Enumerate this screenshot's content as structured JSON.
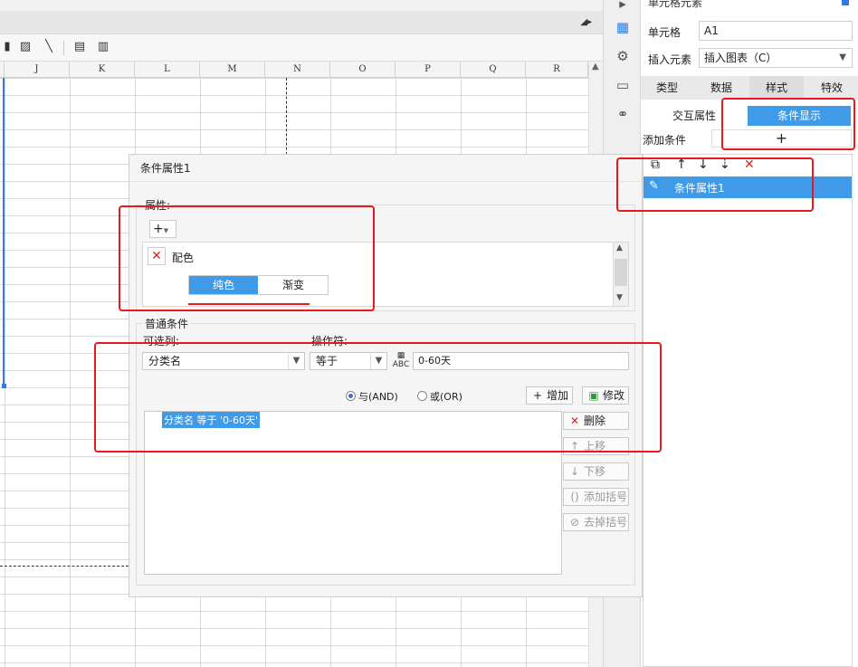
{
  "sheet": {
    "columns": [
      "J",
      "K",
      "L",
      "M",
      "N",
      "O",
      "P",
      "Q",
      "R"
    ]
  },
  "toolbar": {
    "icons": [
      "bar-chart-icon",
      "image-icon",
      "slash-icon",
      "form-icon",
      "list-icon"
    ]
  },
  "right_panel": {
    "title": "单元格元素",
    "cell_label": "单元格",
    "cell_value": "A1",
    "insert_label": "插入元素",
    "insert_value": "插入图表（C）",
    "tabs": [
      "类型",
      "数据",
      "样式",
      "特效"
    ],
    "sub_tabs": [
      "交互属性",
      "条件显示"
    ],
    "add_condition_label": "添加条件",
    "add_condition_btn": "+",
    "conditions": [
      "条件属性1"
    ]
  },
  "dialog": {
    "title": "条件属性1",
    "attr_group_label": "属性:",
    "attr_add_btn": "+",
    "attr_item": "配色",
    "seg_options": [
      "纯色",
      "渐变"
    ],
    "common_group_label": "普通条件",
    "column_label": "可选列:",
    "column_value": "分类名",
    "operator_label": "操作符:",
    "operator_value": "等于",
    "abc_icon": "ABC",
    "value": "0-60天",
    "radio_and": "与(AND)",
    "radio_or": "或(OR)",
    "add_btn": "增加",
    "modify_btn": "修改",
    "condition_text": "分类名 等于 '0-60天'",
    "delete_btn": "删除",
    "up_btn": "上移",
    "down_btn": "下移",
    "add_paren_btn": "添加括号",
    "remove_paren_btn": "去掉括号"
  },
  "colors": {
    "accent": "#3f9ae8",
    "annotation": "#e8191c",
    "delete": "#e02020"
  }
}
